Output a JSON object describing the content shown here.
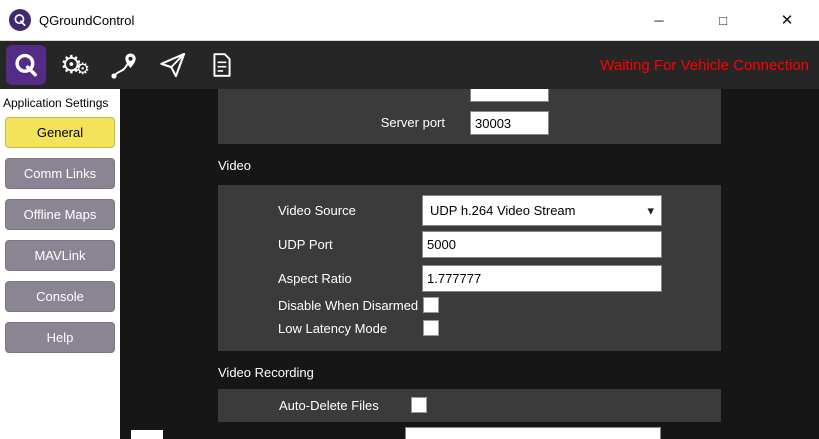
{
  "window": {
    "title": "QGroundControl"
  },
  "icons": {
    "minimize": "─",
    "maximize": "□",
    "close": "✕",
    "gear": "⚙",
    "dropdown_arrow": "▾"
  },
  "toolbar": {
    "status_text": "Waiting For Vehicle Connection",
    "status_color": "#ff0000",
    "buttons": [
      "qgc-home",
      "vehicle-setup",
      "plan",
      "fly",
      "analyze"
    ]
  },
  "sidebar": {
    "header": "Application Settings",
    "items": [
      {
        "label": "General",
        "selected": true
      },
      {
        "label": "Comm Links",
        "selected": false
      },
      {
        "label": "Offline Maps",
        "selected": false
      },
      {
        "label": "MAVLink",
        "selected": false
      },
      {
        "label": "Console",
        "selected": false
      },
      {
        "label": "Help",
        "selected": false
      }
    ]
  },
  "main": {
    "top_section": {
      "server_port_label": "Server port",
      "server_port_value": "30003"
    },
    "video_section": {
      "title": "Video",
      "video_source_label": "Video Source",
      "video_source_value": "UDP h.264 Video Stream",
      "udp_port_label": "UDP Port",
      "udp_port_value": "5000",
      "aspect_ratio_label": "Aspect Ratio",
      "aspect_ratio_value": "1.777777",
      "disable_when_disarmed_label": "Disable When Disarmed",
      "disable_when_disarmed_checked": false,
      "low_latency_mode_label": "Low Latency Mode",
      "low_latency_mode_checked": false
    },
    "video_recording_section": {
      "title": "Video Recording",
      "auto_delete_files_label": "Auto-Delete Files",
      "auto_delete_files_checked": false
    }
  },
  "colors": {
    "accent_purple": "#542c85",
    "sidebar_button": "#8b8593",
    "sidebar_selected": "#f3e35b",
    "panel": "#3b3b3b",
    "content_background": "#161616",
    "status_red": "#ff0000"
  }
}
